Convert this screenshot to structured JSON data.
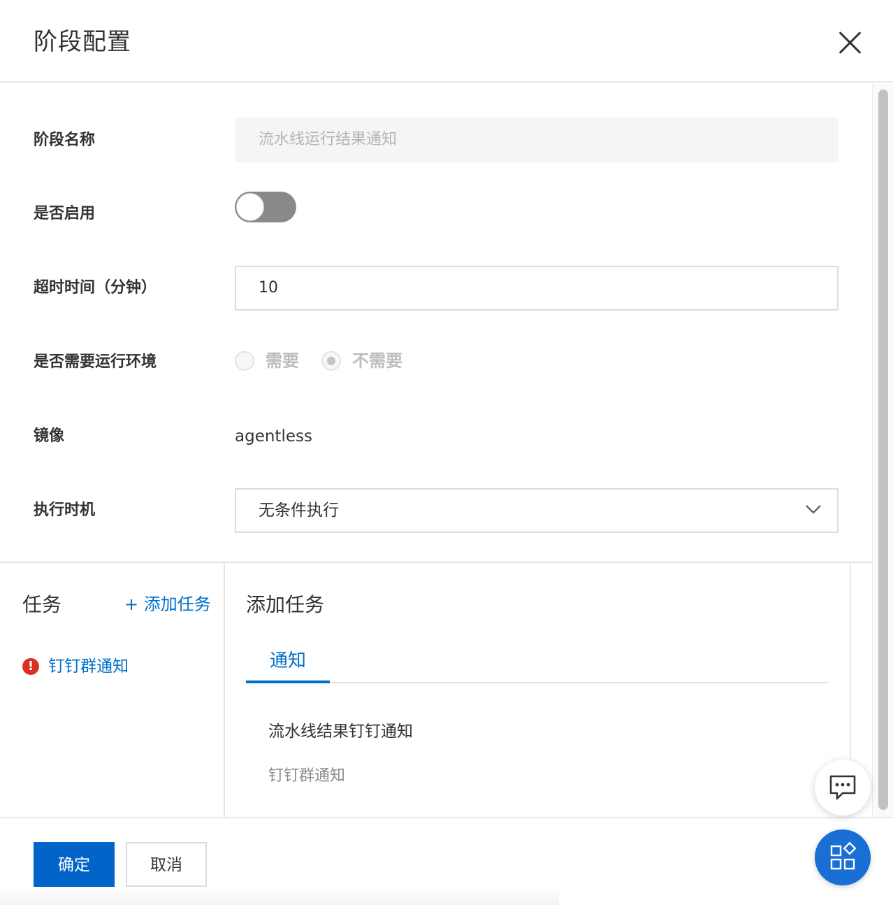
{
  "header": {
    "title": "阶段配置"
  },
  "form": {
    "stage_name": {
      "label": "阶段名称",
      "value": "流水线运行结果通知"
    },
    "enabled": {
      "label": "是否启用",
      "state": "off"
    },
    "timeout": {
      "label": "超时时间（分钟）",
      "value": "10"
    },
    "runtime_env": {
      "label": "是否需要运行环境",
      "option_yes": "需要",
      "option_no": "不需要",
      "selected": "不需要"
    },
    "image": {
      "label": "镜像",
      "value": "agentless"
    },
    "execution": {
      "label": "执行时机",
      "value": "无条件执行"
    }
  },
  "tasks": {
    "title": "任务",
    "add_label": "+ 添加任务",
    "items": [
      {
        "label": "钉钉群通知",
        "status": "error"
      }
    ]
  },
  "add_task_panel": {
    "title": "添加任务",
    "tabs": [
      {
        "label": "通知",
        "active": true
      }
    ],
    "option": {
      "title": "流水线结果钉钉通知",
      "subtitle": "钉钉群通知"
    }
  },
  "footer": {
    "confirm_label": "确定",
    "cancel_label": "取消"
  },
  "colors": {
    "primary": "#0064c8",
    "link": "#0070cc",
    "error": "#d93026"
  }
}
